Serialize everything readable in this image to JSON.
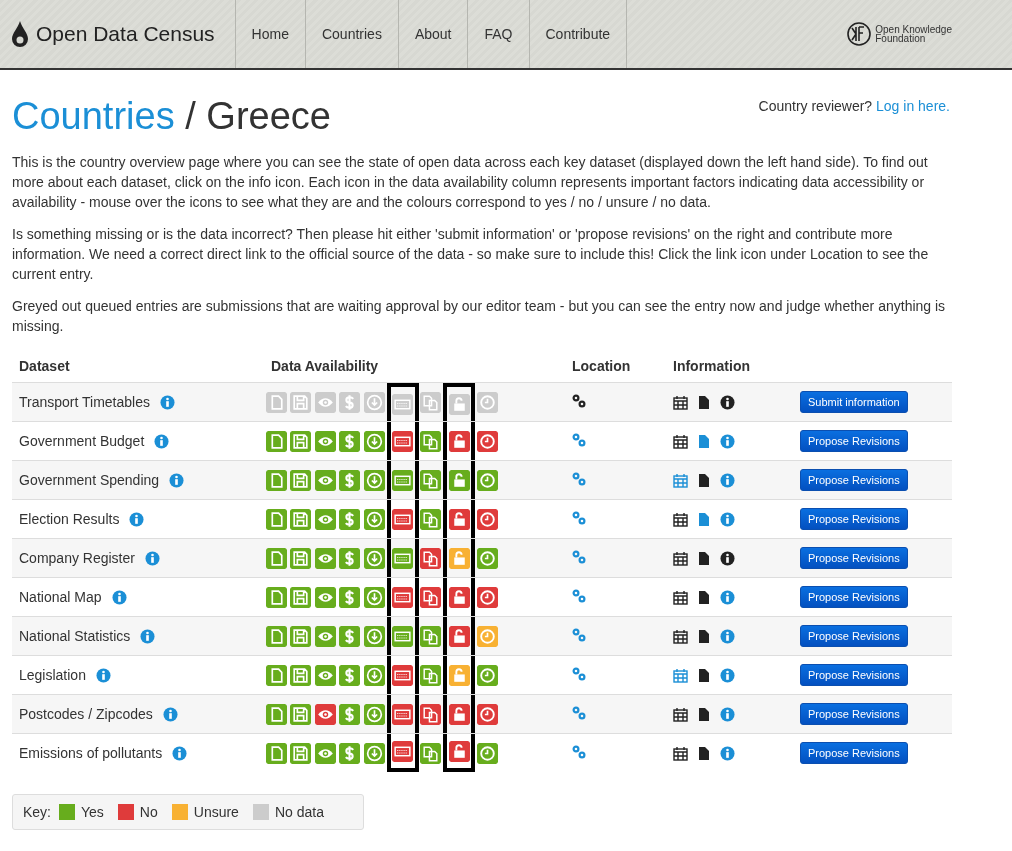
{
  "header": {
    "logo": "Open Data Census",
    "nav": [
      {
        "label": "Home"
      },
      {
        "label": "Countries"
      },
      {
        "label": "About"
      },
      {
        "label": "FAQ"
      },
      {
        "label": "Contribute"
      }
    ],
    "partner_lines": [
      "Open Knowledge",
      "Foundation"
    ]
  },
  "title": {
    "link": "Countries",
    "separator": "/",
    "current": "Greece"
  },
  "reviewer": {
    "text": "Country reviewer?",
    "link": "Log in here."
  },
  "paragraphs": [
    "This is the country overview page where you can see the state of open data across each key dataset (displayed down the left hand side). To find out more about each dataset, click on the info icon. Each icon in the data availability column represents important factors indicating data accessibility or availability - mouse over the icons to see what they are and the colours correspond to yes / no / unsure / no data.",
    "Is something missing or is the data incorrect? Then please hit either 'submit information' or 'propose revisions' on the right and contribute more information. We need a correct direct link to the official source of the data - so make sure to include this! Click the link icon under Location to see the current entry.",
    "Greyed out queued entries are submissions that are waiting approval by our editor team - but you can see the entry now and judge whether anything is missing."
  ],
  "table": {
    "columns": [
      "Dataset",
      "Data Availability",
      "Location",
      "Information"
    ],
    "availability_columns": [
      {
        "outlined": false
      },
      {
        "outlined": false
      },
      {
        "outlined": false
      },
      {
        "outlined": false
      },
      {
        "outlined": false
      },
      {
        "outlined": true
      },
      {
        "outlined": false
      },
      {
        "outlined": true
      },
      {
        "outlined": false
      }
    ],
    "rows": [
      {
        "name": "Transport Timetables",
        "availability": [
          {
            "color": "#cccccc"
          },
          {
            "color": "#cccccc"
          },
          {
            "color": "#cccccc"
          },
          {
            "color": "#cccccc"
          },
          {
            "color": "#cccccc"
          },
          {
            "color": "#cccccc"
          },
          {
            "color": "#cccccc"
          },
          {
            "color": "#cccccc"
          },
          {
            "color": "#cccccc"
          }
        ],
        "location_active": false,
        "date_active": false,
        "document_active": false,
        "info_active": false,
        "action": "Submit information"
      },
      {
        "name": "Government Budget",
        "availability": [
          {
            "color": "#67ad1d"
          },
          {
            "color": "#67ad1d"
          },
          {
            "color": "#67ad1d"
          },
          {
            "color": "#67ad1d"
          },
          {
            "color": "#67ad1d"
          },
          {
            "color": "#df3b3b"
          },
          {
            "color": "#67ad1d"
          },
          {
            "color": "#df3b3b"
          },
          {
            "color": "#df3b3b"
          }
        ],
        "location_active": true,
        "date_active": false,
        "document_active": true,
        "info_active": true,
        "action": "Propose Revisions"
      },
      {
        "name": "Government Spending",
        "availability": [
          {
            "color": "#67ad1d"
          },
          {
            "color": "#67ad1d"
          },
          {
            "color": "#67ad1d"
          },
          {
            "color": "#67ad1d"
          },
          {
            "color": "#67ad1d"
          },
          {
            "color": "#67ad1d"
          },
          {
            "color": "#67ad1d"
          },
          {
            "color": "#67ad1d"
          },
          {
            "color": "#67ad1d"
          }
        ],
        "location_active": true,
        "date_active": true,
        "document_active": false,
        "info_active": true,
        "action": "Propose Revisions"
      },
      {
        "name": "Election Results",
        "availability": [
          {
            "color": "#67ad1d"
          },
          {
            "color": "#67ad1d"
          },
          {
            "color": "#67ad1d"
          },
          {
            "color": "#67ad1d"
          },
          {
            "color": "#67ad1d"
          },
          {
            "color": "#df3b3b"
          },
          {
            "color": "#67ad1d"
          },
          {
            "color": "#df3b3b"
          },
          {
            "color": "#df3b3b"
          }
        ],
        "location_active": true,
        "date_active": false,
        "document_active": true,
        "info_active": true,
        "action": "Propose Revisions"
      },
      {
        "name": "Company Register",
        "availability": [
          {
            "color": "#67ad1d"
          },
          {
            "color": "#67ad1d"
          },
          {
            "color": "#67ad1d"
          },
          {
            "color": "#67ad1d"
          },
          {
            "color": "#67ad1d"
          },
          {
            "color": "#67ad1d"
          },
          {
            "color": "#df3b3b"
          },
          {
            "color": "#f8b133"
          },
          {
            "color": "#67ad1d"
          }
        ],
        "location_active": true,
        "date_active": false,
        "document_active": false,
        "info_active": false,
        "action": "Propose Revisions"
      },
      {
        "name": "National Map",
        "availability": [
          {
            "color": "#67ad1d"
          },
          {
            "color": "#67ad1d"
          },
          {
            "color": "#67ad1d"
          },
          {
            "color": "#67ad1d"
          },
          {
            "color": "#67ad1d"
          },
          {
            "color": "#df3b3b"
          },
          {
            "color": "#df3b3b"
          },
          {
            "color": "#df3b3b"
          },
          {
            "color": "#df3b3b"
          }
        ],
        "location_active": true,
        "date_active": false,
        "document_active": false,
        "info_active": true,
        "action": "Propose Revisions"
      },
      {
        "name": "National Statistics",
        "availability": [
          {
            "color": "#67ad1d"
          },
          {
            "color": "#67ad1d"
          },
          {
            "color": "#67ad1d"
          },
          {
            "color": "#67ad1d"
          },
          {
            "color": "#67ad1d"
          },
          {
            "color": "#67ad1d"
          },
          {
            "color": "#67ad1d"
          },
          {
            "color": "#df3b3b"
          },
          {
            "color": "#f8b133"
          }
        ],
        "location_active": true,
        "date_active": false,
        "document_active": false,
        "info_active": true,
        "action": "Propose Revisions"
      },
      {
        "name": "Legislation",
        "availability": [
          {
            "color": "#67ad1d"
          },
          {
            "color": "#67ad1d"
          },
          {
            "color": "#67ad1d"
          },
          {
            "color": "#67ad1d"
          },
          {
            "color": "#67ad1d"
          },
          {
            "color": "#df3b3b"
          },
          {
            "color": "#67ad1d"
          },
          {
            "color": "#f8b133"
          },
          {
            "color": "#67ad1d"
          }
        ],
        "location_active": true,
        "date_active": true,
        "document_active": false,
        "info_active": true,
        "action": "Propose Revisions"
      },
      {
        "name": "Postcodes / Zipcodes",
        "availability": [
          {
            "color": "#67ad1d"
          },
          {
            "color": "#67ad1d"
          },
          {
            "color": "#df3b3b"
          },
          {
            "color": "#67ad1d"
          },
          {
            "color": "#67ad1d"
          },
          {
            "color": "#df3b3b"
          },
          {
            "color": "#df3b3b"
          },
          {
            "color": "#df3b3b"
          },
          {
            "color": "#df3b3b"
          }
        ],
        "location_active": true,
        "date_active": false,
        "document_active": false,
        "info_active": true,
        "action": "Propose Revisions"
      },
      {
        "name": "Emissions of pollutants",
        "availability": [
          {
            "color": "#67ad1d"
          },
          {
            "color": "#67ad1d"
          },
          {
            "color": "#67ad1d"
          },
          {
            "color": "#67ad1d"
          },
          {
            "color": "#67ad1d"
          },
          {
            "color": "#df3b3b"
          },
          {
            "color": "#67ad1d"
          },
          {
            "color": "#df3b3b"
          },
          {
            "color": "#67ad1d"
          }
        ],
        "location_active": true,
        "date_active": false,
        "document_active": false,
        "info_active": true,
        "action": "Propose Revisions"
      }
    ]
  },
  "key": {
    "label": "Key:",
    "items": [
      {
        "label": "Yes",
        "color": "#67ad1d"
      },
      {
        "label": "No",
        "color": "#df3b3b"
      },
      {
        "label": "Unsure",
        "color": "#f8b133"
      },
      {
        "label": "No data",
        "color": "#cccccc"
      }
    ]
  }
}
